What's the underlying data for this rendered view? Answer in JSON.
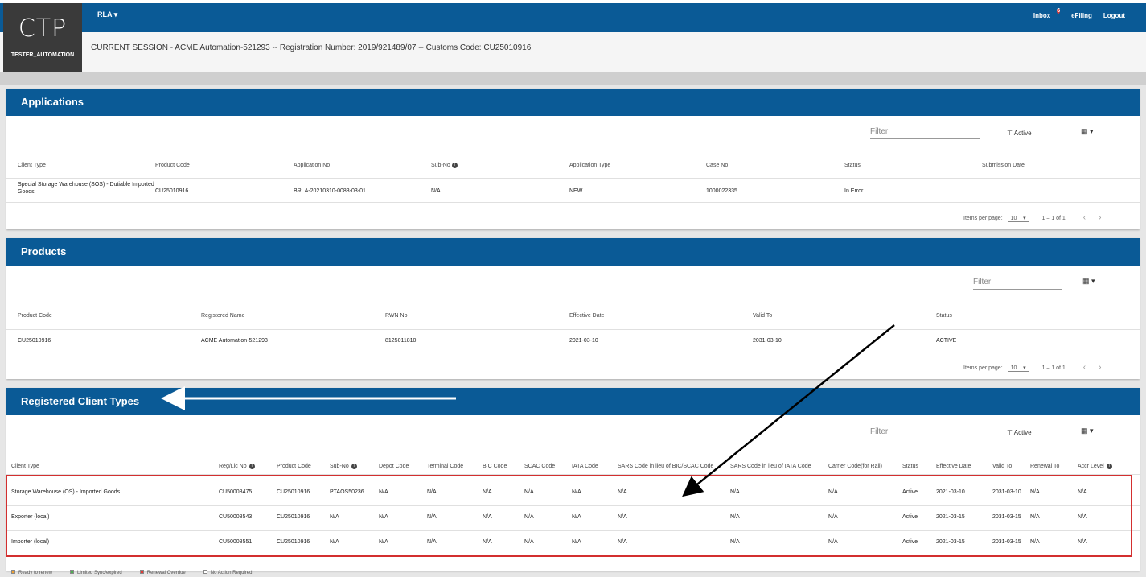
{
  "header": {
    "logo_text": "CTP",
    "user": "TESTER_AUTOMATION",
    "menu_label": "RLA ▾",
    "nav": {
      "inbox": "Inbox",
      "inbox_badge": "6",
      "efiling": "eFiling",
      "logout": "Logout"
    },
    "session_text": "CURRENT SESSION - ACME Automation-521293 -- Registration Number: 2019/921489/07 -- Customs Code: CU25010916"
  },
  "applications": {
    "title": "Applications",
    "filter_placeholder": "Filter",
    "active_label": "Active",
    "columns": [
      "Client Type",
      "Product Code",
      "Application No",
      "Sub-No",
      "Application Type",
      "Case No",
      "Status",
      "Submission Date"
    ],
    "row": {
      "client_type_1": "Special Storage Warehouse (SOS) - Dutiable Imported",
      "client_type_2": "Goods",
      "product_code": "CU25010916",
      "application_no": "BRLA-20210310-0083-03-01",
      "sub_no": "N/A",
      "application_type": "NEW",
      "case_no": "1000022335",
      "status": "In Error",
      "submission_date": ""
    },
    "items_per_page_label": "Items per page:",
    "items_per_page": "10",
    "range": "1 – 1 of 1"
  },
  "products": {
    "title": "Products",
    "filter_placeholder": "Filter",
    "columns": [
      "Product Code",
      "Registered Name",
      "RWN No",
      "Effective Date",
      "Valid To",
      "Status"
    ],
    "row": {
      "product_code": "CU25010916",
      "registered_name": "ACME Automation-521293",
      "rwn_no": "8125011810",
      "effective_date": "2021-03-10",
      "valid_to": "2031-03-10",
      "status": "ACTIVE"
    },
    "items_per_page_label": "Items per page:",
    "items_per_page": "10",
    "range": "1 – 1 of 1"
  },
  "registered": {
    "title": "Registered Client Types",
    "filter_placeholder": "Filter",
    "active_label": "Active",
    "columns": [
      "Client Type",
      "Reg/Lic No",
      "Product Code",
      "Sub-No",
      "Depot Code",
      "Terminal Code",
      "BIC Code",
      "SCAC Code",
      "IATA Code",
      "SARS Code in lieu of BIC/SCAC Code",
      "SARS Code in lieu of IATA Code",
      "Carrier Code(for Rail)",
      "Status",
      "Effective Date",
      "Valid To",
      "Renewal To",
      "Accr Level"
    ],
    "rows": [
      [
        "Storage Warehouse (OS) - Imported Goods",
        "CU50008475",
        "CU25010916",
        "PTAOS50236",
        "N/A",
        "N/A",
        "N/A",
        "N/A",
        "N/A",
        "N/A",
        "N/A",
        "N/A",
        "Active",
        "2021-03-10",
        "2031-03-10",
        "N/A",
        "N/A"
      ],
      [
        "Exporter (local)",
        "CU50008543",
        "CU25010916",
        "N/A",
        "N/A",
        "N/A",
        "N/A",
        "N/A",
        "N/A",
        "N/A",
        "N/A",
        "N/A",
        "Active",
        "2021-03-15",
        "2031-03-15",
        "N/A",
        "N/A"
      ],
      [
        "Importer (local)",
        "CU50008551",
        "CU25010916",
        "N/A",
        "N/A",
        "N/A",
        "N/A",
        "N/A",
        "N/A",
        "N/A",
        "N/A",
        "N/A",
        "Active",
        "2021-03-15",
        "2031-03-15",
        "N/A",
        "N/A"
      ]
    ],
    "legend": [
      "Ready to renew",
      "Limited Sync/expired",
      "Renewal Overdue",
      "No Action Required"
    ]
  },
  "colors": {
    "brand": "#0a5a96",
    "highlight": "#d32f2f"
  }
}
